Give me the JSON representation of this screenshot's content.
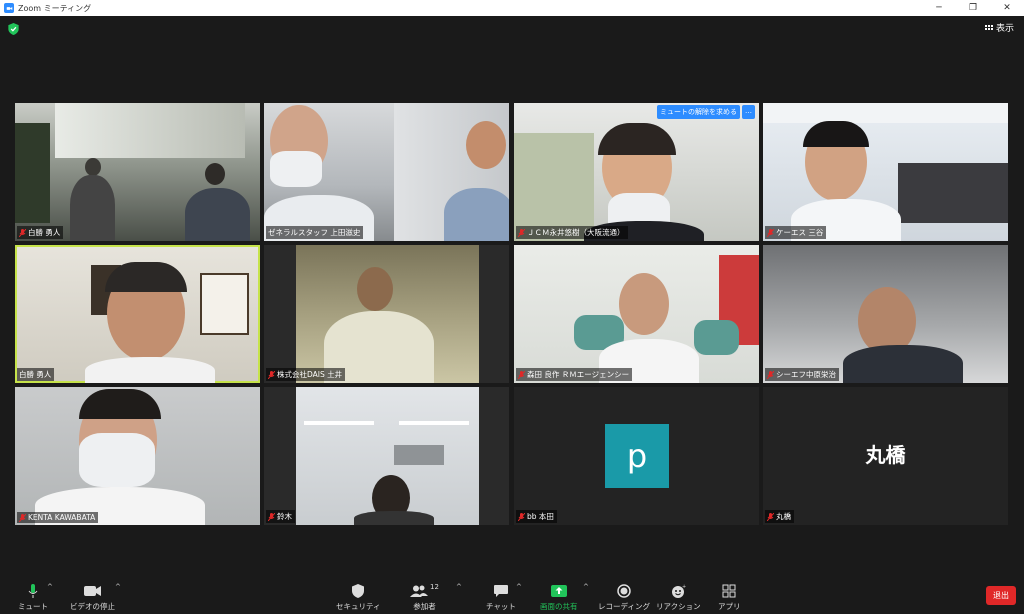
{
  "window": {
    "title": "Zoom ミーティング"
  },
  "header": {
    "view_label": "表示"
  },
  "tiles": [
    {
      "name": "白勝 勇人"
    },
    {
      "name": "ゼネラルスタッフ 上田滋史"
    },
    {
      "name": "ＪＣＭ永井悠樹（大阪流通）",
      "unmute_request": "ミュートの解除を求める",
      "more": "…"
    },
    {
      "name": "ケーエス 三谷"
    },
    {
      "name": "白勝 勇人"
    },
    {
      "name": "株式会社DAIS 土井"
    },
    {
      "name": "森田 良作 ＲＭエージェンシー"
    },
    {
      "name": "シーエフ中原栄治"
    },
    {
      "name": "KENTA KAWABATA"
    },
    {
      "name": "鈴木"
    },
    {
      "name": "bb 本田",
      "avatar_letter": "p",
      "avatar_color": "#1a9aa8"
    },
    {
      "name": "丸橋",
      "display_text": "丸橋"
    }
  ],
  "toolbar": {
    "mute": "ミュート",
    "video": "ビデオの停止",
    "security": "セキュリティ",
    "participants": "参加者",
    "participants_count": "12",
    "chat": "チャット",
    "share": "画面の共有",
    "record": "レコーディング",
    "reactions": "リアクション",
    "apps": "アプリ",
    "leave": "退出"
  },
  "colors": {
    "accent": "#2d8cff",
    "share_green": "#21c45a",
    "leave_red": "#e02828",
    "speaking_border": "#c6e34a"
  }
}
